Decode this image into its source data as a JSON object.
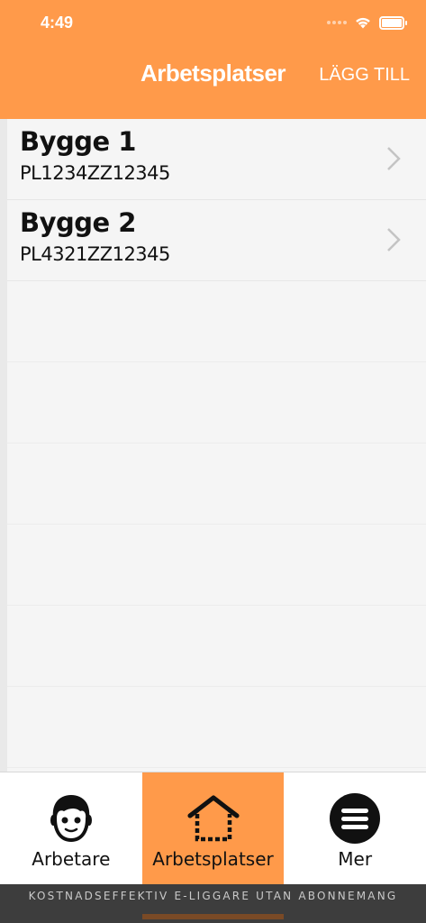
{
  "status_bar": {
    "time": "4:49"
  },
  "header": {
    "title": "Arbetsplatser",
    "action_label": "LÄGG TILL"
  },
  "workplaces": [
    {
      "name": "Bygge 1",
      "code": "PL1234ZZ12345"
    },
    {
      "name": "Bygge 2",
      "code": "PL4321ZZ12345"
    }
  ],
  "tabs": [
    {
      "label": "Arbetare",
      "icon": "worker-face-icon",
      "active": false
    },
    {
      "label": "Arbetsplatser",
      "icon": "house-icon",
      "active": true
    },
    {
      "label": "Mer",
      "icon": "menu-icon",
      "active": false
    }
  ],
  "footer": {
    "text": "KOSTNADSEFFEKTIV E-LIGGARE UTAN ABONNEMANG"
  },
  "colors": {
    "accent": "#ff9a4a",
    "footer_bg": "#3d3d3d"
  }
}
